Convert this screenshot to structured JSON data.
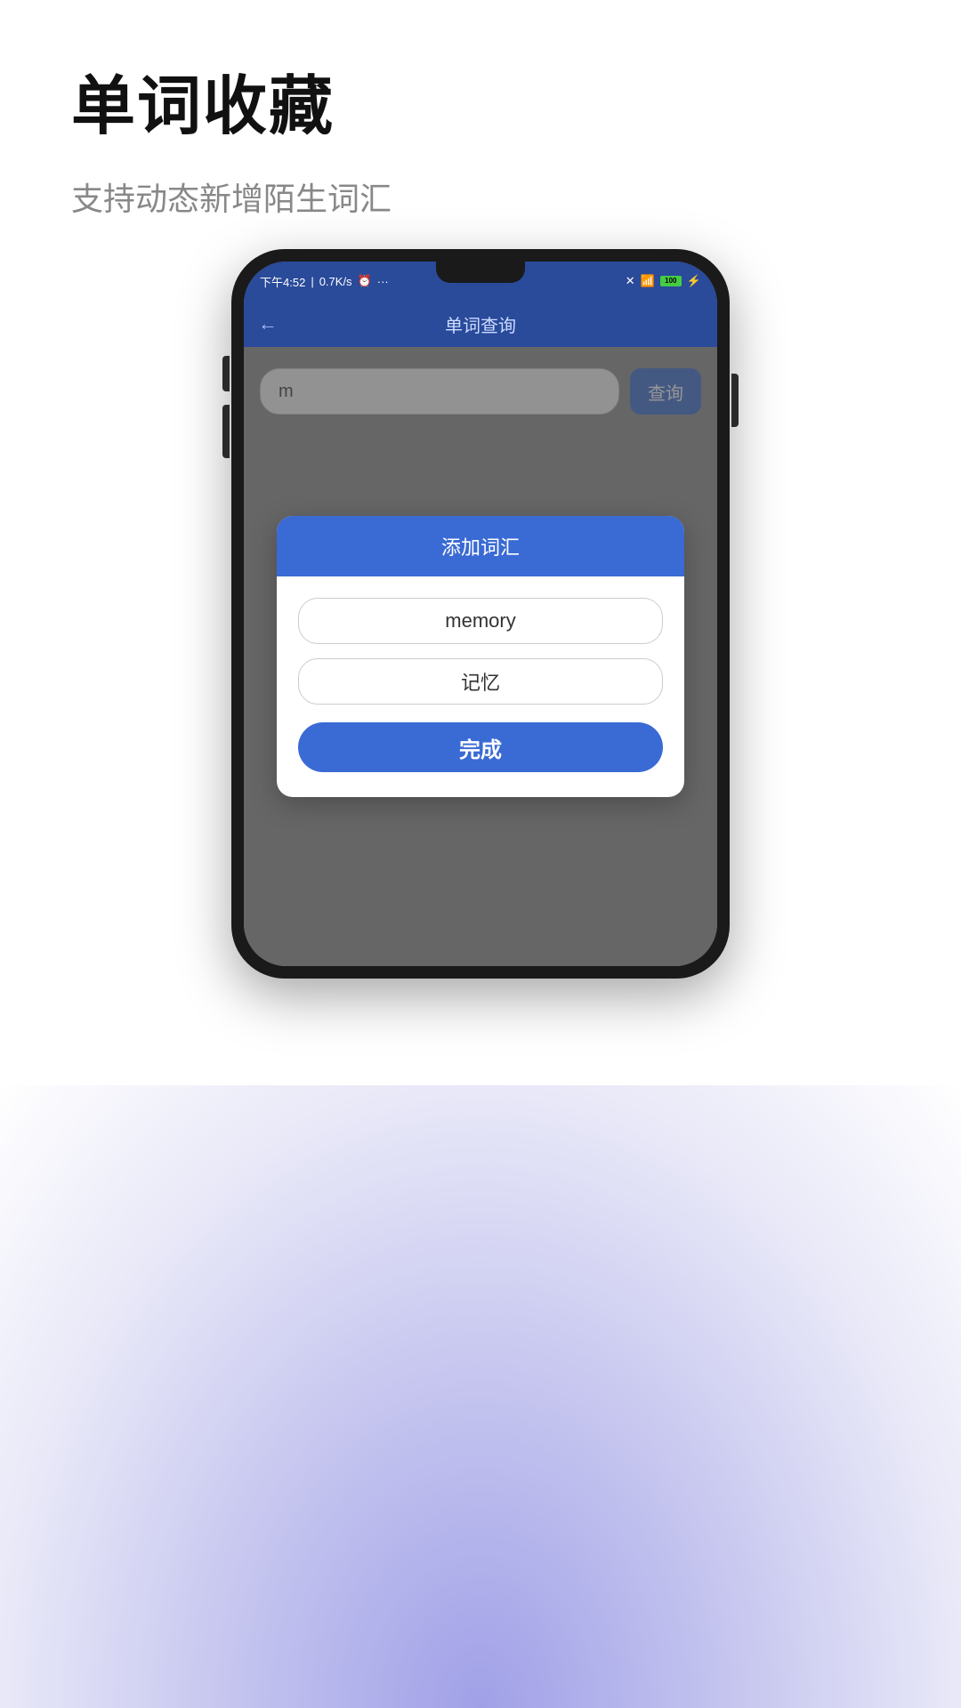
{
  "page": {
    "title": "单词收藏",
    "subtitle": "支持动态新增陌生词汇"
  },
  "status_bar": {
    "time": "下午4:52",
    "network": "0.7K/s",
    "battery": "100"
  },
  "nav": {
    "title": "单词查询",
    "back_icon": "←"
  },
  "search": {
    "input_value": "m",
    "button_label": "查询",
    "placeholder": ""
  },
  "dialog": {
    "header_label": "添加词汇",
    "word_field": "memory",
    "translation_field": "记忆",
    "confirm_button_label": "完成"
  }
}
